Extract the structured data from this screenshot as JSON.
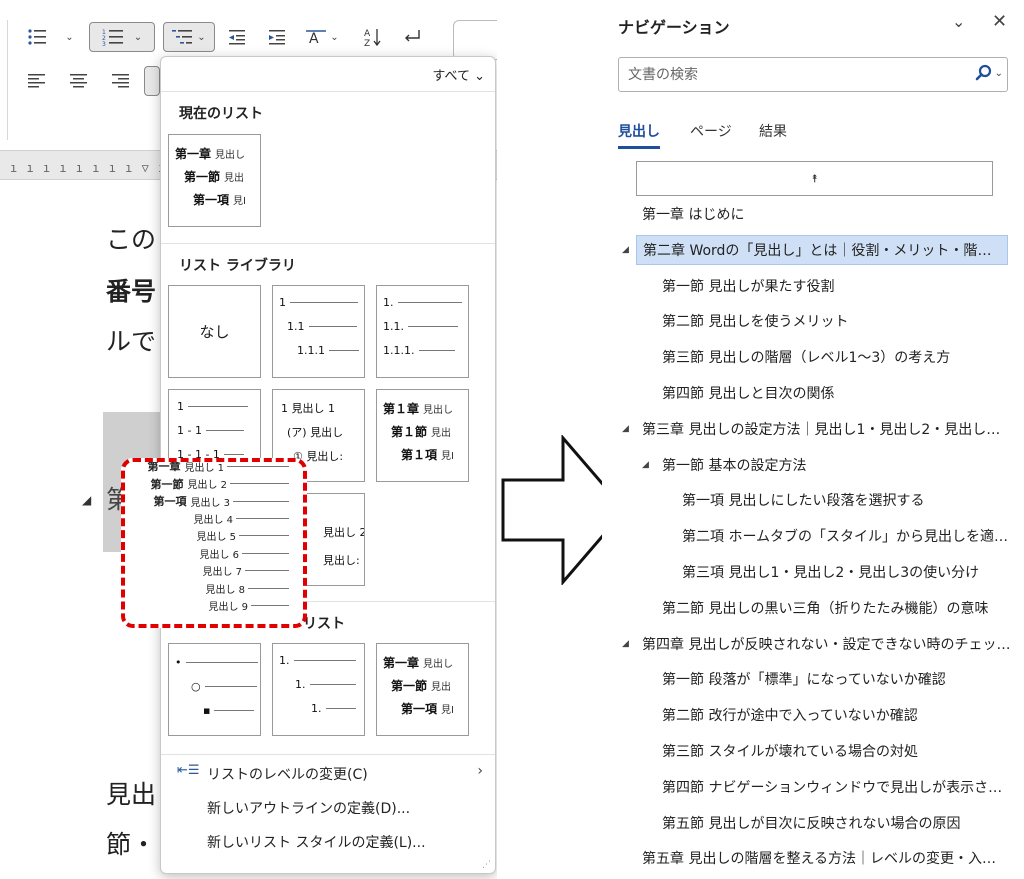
{
  "list_dropdown": {
    "filter_label": "すべて",
    "current_heading": "現在のリスト",
    "library_heading": "リスト ライブラリ",
    "doc_heading": "リスト",
    "none_label": "なし",
    "menu": {
      "change_level": "リストのレベルの変更(C)",
      "define_outline": "新しいアウトラインの定義(D)...",
      "define_style": "新しいリスト スタイルの定義(L)..."
    },
    "tiles": {
      "chapter": "第一章",
      "section": "第一節",
      "article": "第一項",
      "heading_short": "見出し",
      "heading_short_clip": "見出",
      "heading_short_clip2": "見Ⅰ",
      "n1": "1",
      "n11": "1.1",
      "n111": "1.1.1",
      "d1": "1.",
      "d11": "1.1.",
      "d111": "1.1.1.",
      "dash1": "1",
      "dash2": "1 - 1",
      "dash3": "1 - 1 - 1",
      "midot": "1 見出し 1",
      "kata": "(ア) 見出し",
      "circ": "① 見出し:",
      "ch1": "第１章",
      "sec1": "第１節",
      "art1": "第１項",
      "heading2": "見出し 2",
      "heading2b": "見出し 2=",
      "heading_colon": "見出し:"
    },
    "preview_lines": [
      {
        "prefix": "第一章",
        "label": "見出し 1"
      },
      {
        "prefix": "第一節",
        "label": "見出し 2"
      },
      {
        "prefix": "第一項",
        "label": "見出し 3"
      },
      {
        "prefix": "",
        "label": "見出し 4"
      },
      {
        "prefix": "",
        "label": "見出し 5"
      },
      {
        "prefix": "",
        "label": "見出し 6"
      },
      {
        "prefix": "",
        "label": "見出し 7"
      },
      {
        "prefix": "",
        "label": "見出し 8"
      },
      {
        "prefix": "",
        "label": "見出し 9"
      }
    ]
  },
  "document": {
    "lines": [
      "この",
      "番号",
      "ルで",
      "第",
      "見出",
      "節・"
    ]
  },
  "nav": {
    "title": "ナビゲーション",
    "search_placeholder": "文書の検索",
    "tabs": [
      "見出し",
      "ページ",
      "結果"
    ],
    "collapse_glyph": "⯭",
    "items": [
      {
        "text": "第一章 はじめに",
        "level": 0,
        "tri": "",
        "selected": false
      },
      {
        "text": "第二章 Wordの「見出し」とは｜役割・メリット・階層構造…",
        "level": 0,
        "tri": "◢",
        "selected": true
      },
      {
        "text": "第一節 見出しが果たす役割",
        "level": 1,
        "tri": "",
        "selected": false
      },
      {
        "text": "第二節 見出しを使うメリット",
        "level": 1,
        "tri": "",
        "selected": false
      },
      {
        "text": "第三節 見出しの階層（レベル1～3）の考え方",
        "level": 1,
        "tri": "",
        "selected": false
      },
      {
        "text": "第四節 見出しと目次の関係",
        "level": 1,
        "tri": "",
        "selected": false
      },
      {
        "text": "第三章 見出しの設定方法｜見出し1・見出し2・見出し…",
        "level": 0,
        "tri": "◢",
        "selected": false
      },
      {
        "text": "第一節 基本の設定方法",
        "level": 1,
        "tri": "◢",
        "selected": false
      },
      {
        "text": "第一項 見出しにしたい段落を選択する",
        "level": 2,
        "tri": "",
        "selected": false
      },
      {
        "text": "第二項 ホームタブの「スタイル」から見出しを適用する",
        "level": 2,
        "tri": "",
        "selected": false
      },
      {
        "text": "第三項 見出し1・見出し2・見出し3の使い分け",
        "level": 2,
        "tri": "",
        "selected": false
      },
      {
        "text": "第二節 見出しの黒い三角（折りたたみ機能）の意味",
        "level": 1,
        "tri": "",
        "selected": false
      },
      {
        "text": "第四章 見出しが反映されない・設定できない時のチェック…",
        "level": 0,
        "tri": "◢",
        "selected": false
      },
      {
        "text": "第一節 段落が「標準」になっていないか確認",
        "level": 1,
        "tri": "",
        "selected": false
      },
      {
        "text": "第二節 改行が途中で入っていないか確認",
        "level": 1,
        "tri": "",
        "selected": false
      },
      {
        "text": "第三節 スタイルが壊れている場合の対処",
        "level": 1,
        "tri": "",
        "selected": false
      },
      {
        "text": "第四節 ナビゲーションウィンドウで見出しが表示される…",
        "level": 1,
        "tri": "",
        "selected": false
      },
      {
        "text": "第五節 見出しが目次に反映されない場合の原因",
        "level": 1,
        "tri": "",
        "selected": false
      },
      {
        "text": "第五章 見出しの階層を整える方法｜レベルの変更・入…",
        "level": 0,
        "tri": "",
        "selected": false
      }
    ]
  },
  "colors": {
    "accent": "#1f4e9a",
    "highlight_border": "#e00000",
    "selection_bg": "#cfe0f6"
  }
}
